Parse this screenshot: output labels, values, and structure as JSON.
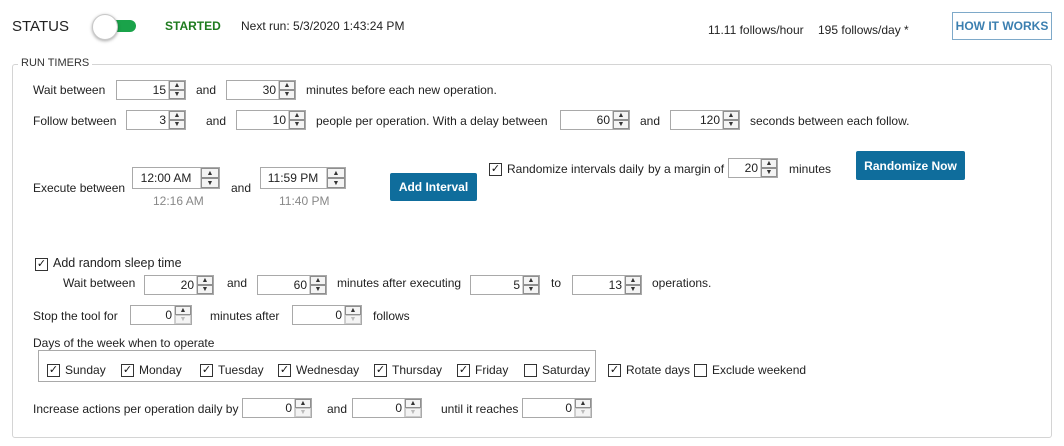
{
  "header": {
    "status_label": "STATUS",
    "status_text": "STARTED",
    "next_run": "Next run: 5/3/2020 1:43:24 PM",
    "follows_hour": "11.11 follows/hour",
    "follows_day": "195 follows/day *",
    "how_it_works": "HOW IT WORKS",
    "toggle_on": true
  },
  "run_timers": {
    "legend": "RUN TIMERS",
    "wait_between": {
      "label": "Wait between",
      "min": "15",
      "and": "and",
      "max": "30",
      "suffix": "minutes before each new operation."
    },
    "follow_between": {
      "label": "Follow between",
      "min": "3",
      "and": "and",
      "max": "10",
      "mid": "people per operation. With a delay between",
      "delay_min": "60",
      "and2": "and",
      "delay_max": "120",
      "suffix": "seconds between each follow."
    },
    "execute": {
      "label": "Execute between",
      "start": "12:00 AM",
      "start_sub": "12:16 AM",
      "and": "and",
      "end": "11:59 PM",
      "end_sub": "11:40 PM",
      "add_interval": "Add Interval"
    },
    "randomize": {
      "label": "Randomize intervals daily",
      "margin_label": "by a margin of",
      "margin": "20",
      "unit": "minutes",
      "checked": true,
      "button": "Randomize Now"
    },
    "sleep": {
      "label": "Add random sleep time",
      "checked": true,
      "wait_label": "Wait between",
      "min": "20",
      "and": "and",
      "max": "60",
      "after": "minutes after executing",
      "ops_min": "5",
      "to": "to",
      "ops_max": "13",
      "suffix": "operations."
    },
    "stop": {
      "label": "Stop the tool for",
      "minutes": "0",
      "after": "minutes after",
      "follows": "0",
      "suffix": "follows"
    },
    "days": {
      "label": "Days of the week when to operate",
      "items": [
        {
          "label": "Sunday",
          "checked": true
        },
        {
          "label": "Monday",
          "checked": true
        },
        {
          "label": "Tuesday",
          "checked": true
        },
        {
          "label": "Wednesday",
          "checked": true
        },
        {
          "label": "Thursday",
          "checked": true
        },
        {
          "label": "Friday",
          "checked": true
        },
        {
          "label": "Saturday",
          "checked": false
        }
      ],
      "rotate": {
        "label": "Rotate days",
        "checked": true
      },
      "exclude": {
        "label": "Exclude weekend",
        "checked": false
      }
    },
    "increase": {
      "label": "Increase actions per operation daily by",
      "a": "0",
      "and": "and",
      "b": "0",
      "until": "until it reaches",
      "c": "0"
    }
  },
  "icons": {
    "check": "check-icon",
    "up": "arrow-up-icon",
    "down": "arrow-down-icon"
  },
  "colors": {
    "accent_green": "#1aa34a",
    "started_green": "#1e7b1e",
    "button_blue": "#0f6d9c",
    "link_blue": "#3b7fb0"
  }
}
